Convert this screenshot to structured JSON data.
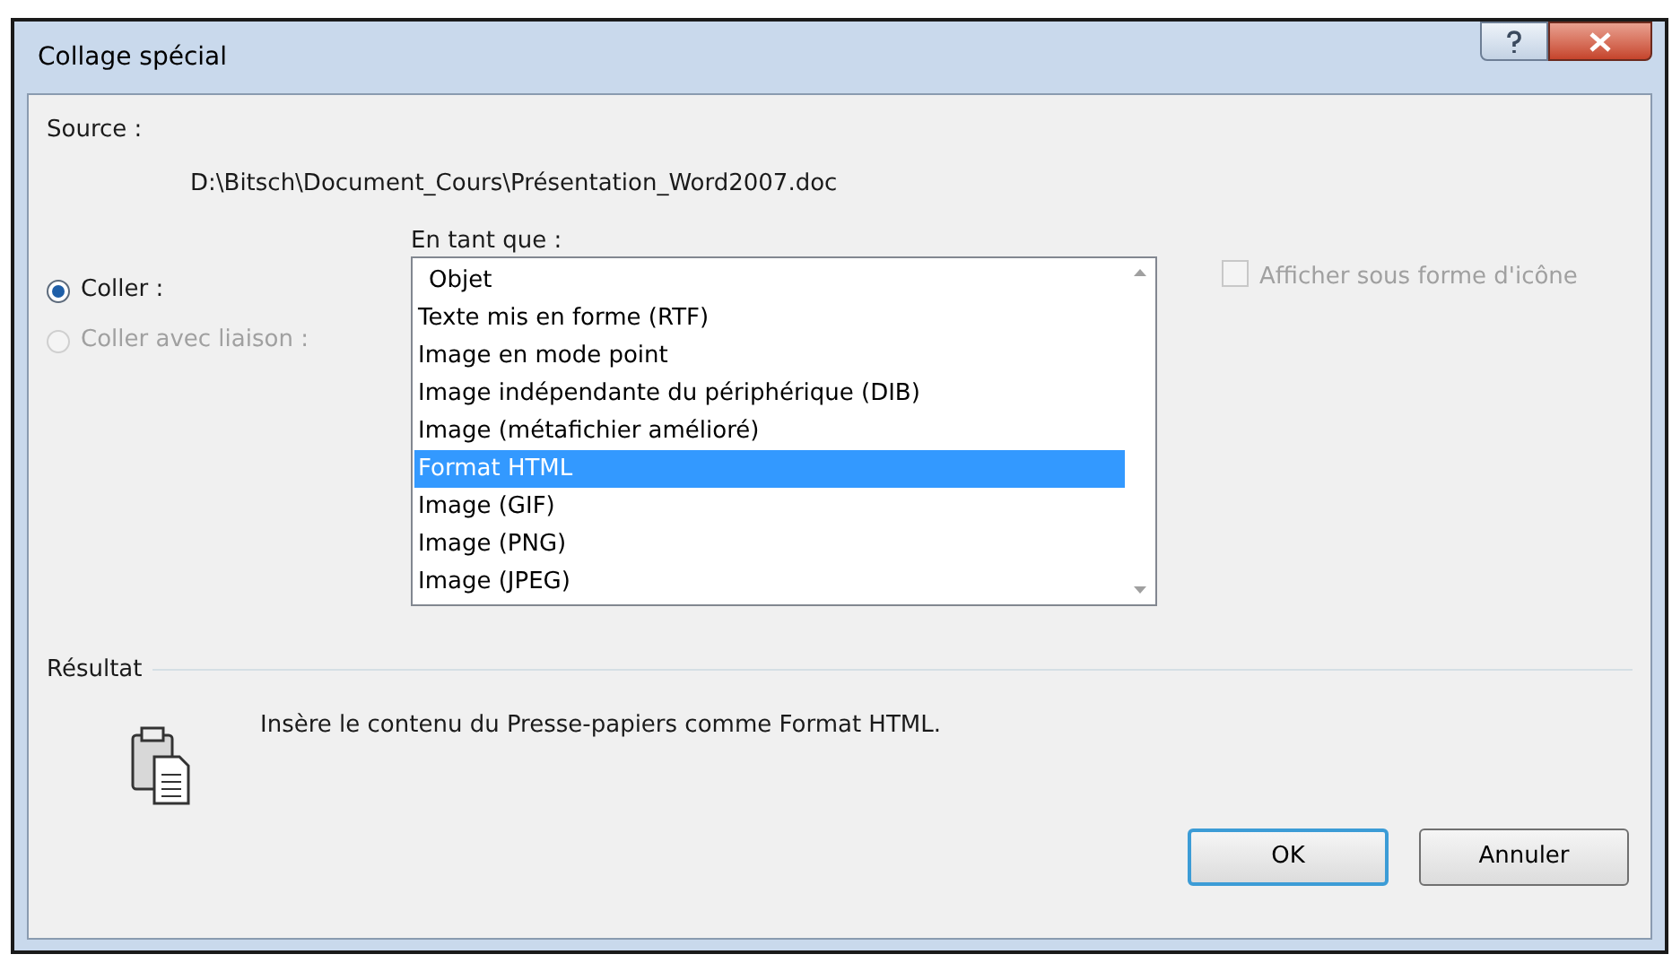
{
  "window": {
    "title": "Collage spécial"
  },
  "source": {
    "label": "Source :",
    "path": "D:\\Bitsch\\Document_Cours\\Présentation_Word2007.doc"
  },
  "paste_options": [
    {
      "label": "Coller :",
      "selected": true,
      "disabled": false
    },
    {
      "label": "Coller avec liaison :",
      "selected": false,
      "disabled": true
    }
  ],
  "format_list": {
    "label": "En tant que :",
    "items": [
      {
        "label": "Objet",
        "selected": false
      },
      {
        "label": "Texte mis en forme (RTF)",
        "selected": false
      },
      {
        "label": "Image en mode point",
        "selected": false
      },
      {
        "label": "Image indépendante du périphérique (DIB)",
        "selected": false
      },
      {
        "label": "Image (métafichier amélioré)",
        "selected": false
      },
      {
        "label": "Format HTML",
        "selected": true
      },
      {
        "label": "Image (GIF)",
        "selected": false
      },
      {
        "label": "Image (PNG)",
        "selected": false
      },
      {
        "label": "Image (JPEG)",
        "selected": false
      }
    ]
  },
  "display_as_icon": {
    "label": "Afficher sous forme d'icône",
    "checked": false,
    "disabled": true
  },
  "result": {
    "label": "Résultat",
    "text": "Insère le contenu du Presse-papiers comme Format HTML."
  },
  "buttons": [
    {
      "label": "OK",
      "default": true
    },
    {
      "label": "Annuler",
      "default": false
    }
  ]
}
